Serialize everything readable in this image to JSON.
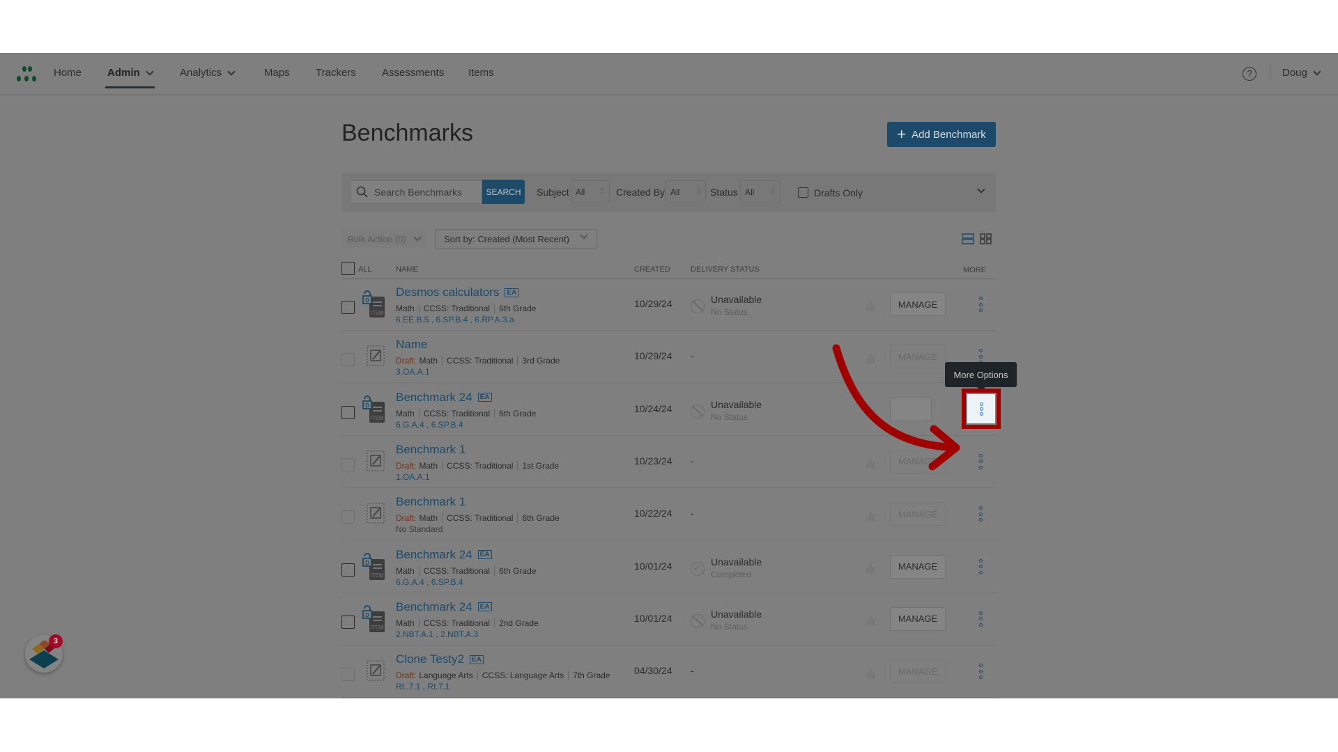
{
  "nav": {
    "items": [
      {
        "label": "Home"
      },
      {
        "label": "Admin",
        "active": true,
        "dropdown": true
      },
      {
        "label": "Analytics",
        "dropdown": true
      },
      {
        "label": "Maps"
      },
      {
        "label": "Trackers"
      },
      {
        "label": "Assessments"
      },
      {
        "label": "Items"
      }
    ],
    "help_icon": "question-circle-icon",
    "user": "Doug"
  },
  "page": {
    "title": "Benchmarks",
    "add_button": "Add Benchmark"
  },
  "filters": {
    "search_placeholder": "Search Benchmarks",
    "search_button": "SEARCH",
    "subject_label": "Subject",
    "subject_value": "All",
    "created_by_label": "Created By",
    "created_by_value": "All",
    "status_label": "Status",
    "status_value": "All",
    "drafts_only": "Drafts Only"
  },
  "toolbar": {
    "bulk_action": "Bulk Action (0)",
    "sort": "Sort by: Created (Most Recent)"
  },
  "table": {
    "headers": {
      "all": "ALL",
      "name": "NAME",
      "created": "CREATED",
      "delivery": "DELIVERY STATUS",
      "more": "MORE"
    },
    "manage_label": "MANAGE",
    "draft_label": "Draft:",
    "rows": [
      {
        "name": "Desmos calculators",
        "ea": "EA",
        "draft": false,
        "subject": "Math",
        "framework": "CCSS: Traditional",
        "grade": "6th Grade",
        "standards": "6.EE.B.5 , 6.SP.B.4 , 6.RP.A.3.a",
        "created": "10/29/24",
        "status": "Unavailable",
        "substatus": "No Status",
        "status_icon": "block"
      },
      {
        "name": "Name",
        "ea": "",
        "draft": true,
        "subject": "Math",
        "framework": "CCSS: Traditional",
        "grade": "3rd Grade",
        "standards": "3.OA.A.1",
        "created": "10/29/24",
        "status": "-",
        "substatus": "",
        "status_icon": ""
      },
      {
        "name": "Benchmark 24",
        "ea": "EA",
        "draft": false,
        "subject": "Math",
        "framework": "CCSS: Traditional",
        "grade": "6th Grade",
        "standards": "6.G.A.4 , 6.SP.B.4",
        "created": "10/24/24",
        "status": "Unavailable",
        "substatus": "No Status",
        "status_icon": "block"
      },
      {
        "name": "Benchmark 1",
        "ea": "",
        "draft": true,
        "subject": "Math",
        "framework": "CCSS: Traditional",
        "grade": "1st Grade",
        "standards": "1.OA.A.1",
        "created": "10/23/24",
        "status": "-",
        "substatus": "",
        "status_icon": ""
      },
      {
        "name": "Benchmark 1",
        "ea": "",
        "draft": true,
        "subject": "Math",
        "framework": "CCSS: Traditional",
        "grade": "6th Grade",
        "standards": "No Standard",
        "created": "10/22/24",
        "status": "-",
        "substatus": "",
        "status_icon": ""
      },
      {
        "name": "Benchmark 24",
        "ea": "EA",
        "draft": false,
        "subject": "Math",
        "framework": "CCSS: Traditional",
        "grade": "6th Grade",
        "standards": "6.G.A.4 , 6.SP.B.4",
        "created": "10/01/24",
        "status": "Unavailable",
        "substatus": "Completed",
        "status_icon": "check"
      },
      {
        "name": "Benchmark 24",
        "ea": "EA",
        "draft": false,
        "subject": "Math",
        "framework": "CCSS: Traditional",
        "grade": "2nd Grade",
        "standards": "2.NBT.A.1 , 2.NBT.A.3",
        "created": "10/01/24",
        "status": "Unavailable",
        "substatus": "No Status",
        "status_icon": "block"
      },
      {
        "name": "Clone Testy2",
        "ea": "EA",
        "draft": true,
        "subject": "Language Arts",
        "framework": "CCSS: Language Arts",
        "grade": "7th Grade",
        "standards": "RL.7.1 , RI.7.1",
        "created": "04/30/24",
        "status": "-",
        "substatus": "",
        "status_icon": ""
      }
    ]
  },
  "tooltip": "More Options",
  "widget": {
    "badge": "3"
  },
  "colors": {
    "accent": "#1d4a6a",
    "highlight": "#a00000",
    "draft": "#7e2e10"
  }
}
